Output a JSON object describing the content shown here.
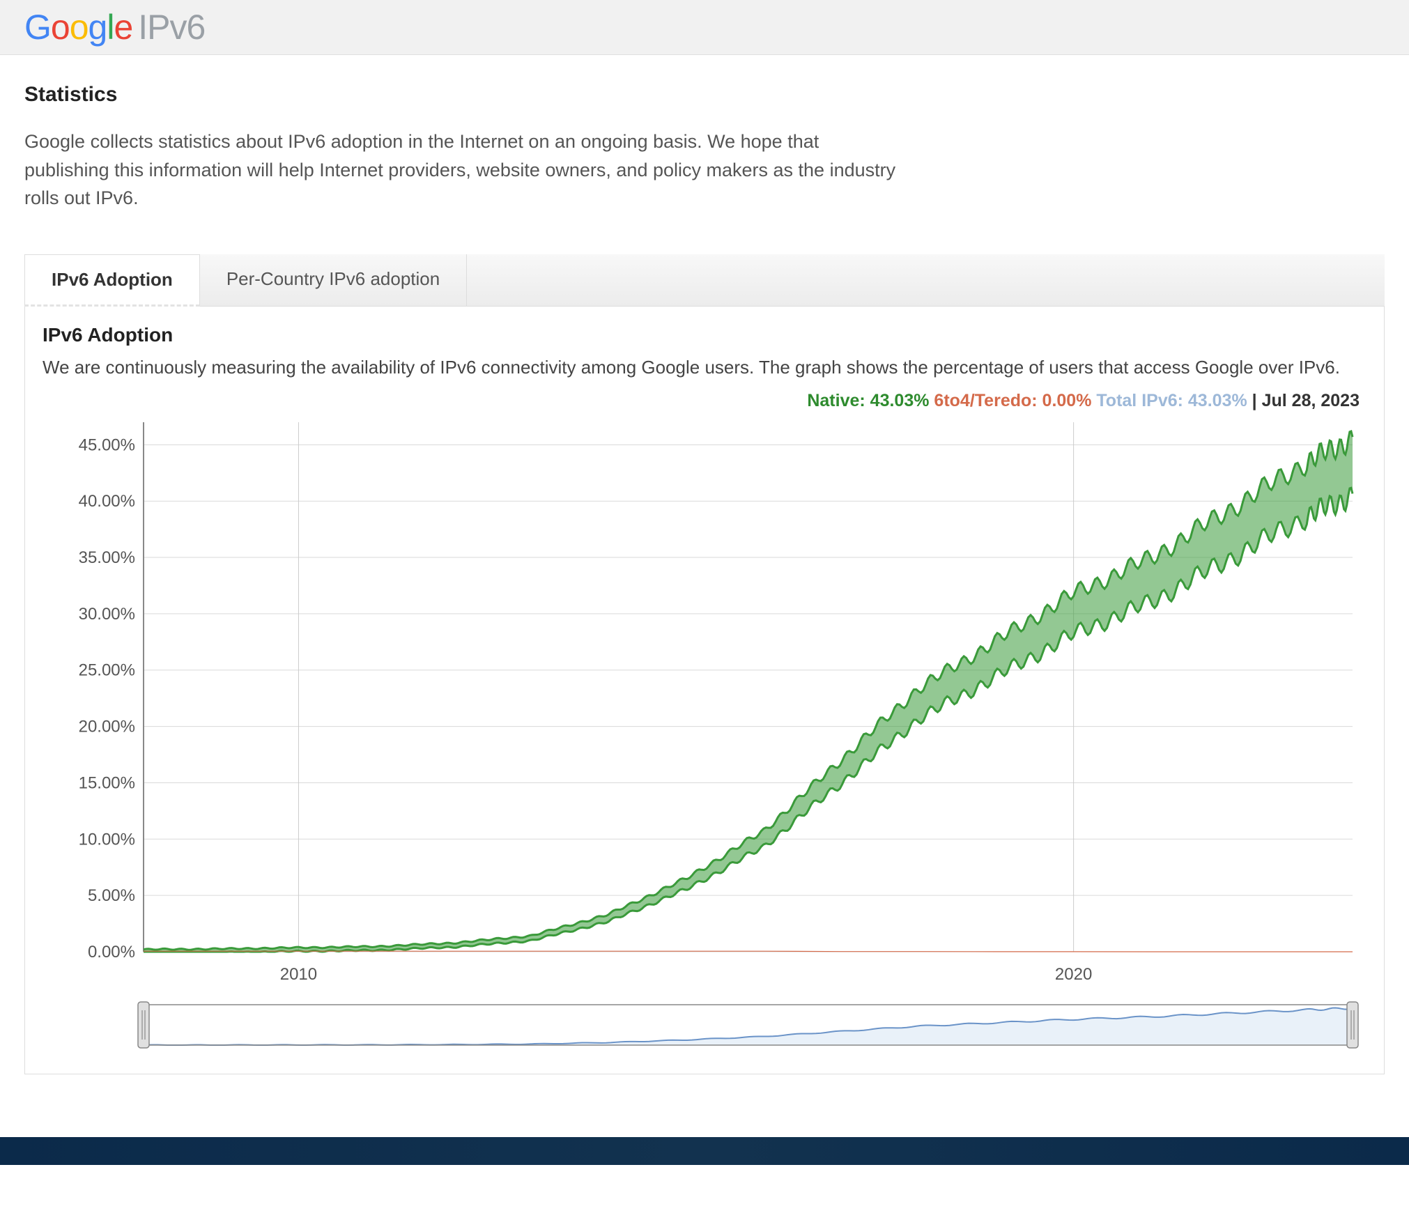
{
  "header": {
    "brand": "Google",
    "suffix": "IPv6"
  },
  "page": {
    "title": "Statistics",
    "intro": "Google collects statistics about IPv6 adoption in the Internet on an ongoing basis. We hope that publishing this information will help Internet providers, website owners, and policy makers as the industry rolls out IPv6."
  },
  "tabs": [
    {
      "label": "IPv6 Adoption",
      "active": true
    },
    {
      "label": "Per-Country IPv6 adoption",
      "active": false
    }
  ],
  "panel": {
    "title": "IPv6 Adoption",
    "description": "We are continuously measuring the availability of IPv6 connectivity among Google users. The graph shows the percentage of users that access Google over IPv6."
  },
  "legend": {
    "native_label": "Native:",
    "native_value": "43.03%",
    "sixto4_label": "6to4/Teredo:",
    "sixto4_value": "0.00%",
    "total_label": "Total IPv6:",
    "total_value": "43.03%",
    "date": "Jul 28, 2023"
  },
  "chart_data": {
    "type": "line",
    "title": "IPv6 Adoption",
    "xlabel": "",
    "ylabel": "",
    "x_ticks": [
      2010,
      2020
    ],
    "y_ticks": [
      "0.00%",
      "5.00%",
      "10.00%",
      "15.00%",
      "20.00%",
      "25.00%",
      "30.00%",
      "35.00%",
      "40.00%",
      "45.00%"
    ],
    "x_range": [
      2008,
      2023.6
    ],
    "ylim": [
      0,
      47
    ],
    "legend_position": "top-right",
    "grid": true,
    "x": [
      2008,
      2009,
      2010,
      2011,
      2012,
      2013,
      2014,
      2015,
      2016,
      2017,
      2018,
      2019,
      2020,
      2021,
      2022,
      2023,
      2023.6
    ],
    "series": [
      {
        "name": "Native",
        "color": "#3a9a3a",
        "values": [
          0.05,
          0.1,
          0.2,
          0.3,
          0.6,
          1.2,
          3.0,
          6.0,
          10.0,
          16.0,
          22.0,
          26.0,
          30.0,
          33.0,
          37.0,
          41.0,
          43.03
        ]
      },
      {
        "name": "6to4/Teredo",
        "color": "#d46a4a",
        "values": [
          0.05,
          0.05,
          0.05,
          0.05,
          0.05,
          0.05,
          0.05,
          0.05,
          0.05,
          0.02,
          0.02,
          0.01,
          0.01,
          0.0,
          0.0,
          0.0,
          0.0
        ]
      },
      {
        "name": "Total IPv6",
        "color": "#9db8d8",
        "values": [
          0.1,
          0.15,
          0.25,
          0.35,
          0.65,
          1.25,
          3.05,
          6.05,
          10.05,
          16.02,
          22.02,
          26.01,
          30.01,
          33.0,
          37.0,
          41.0,
          43.03
        ]
      }
    ],
    "current_point": {
      "date": "Jul 28, 2023",
      "native": 43.03,
      "sixto4": 0.0,
      "total": 43.03
    }
  }
}
